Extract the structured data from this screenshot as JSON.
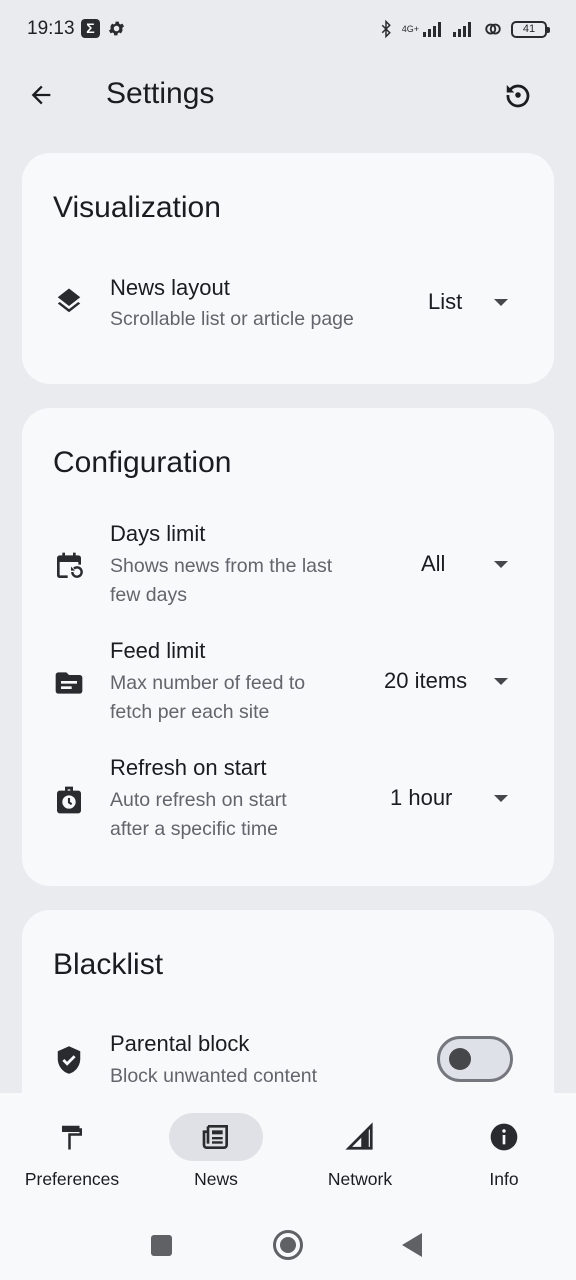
{
  "status_bar": {
    "time": "19:13",
    "sigma": "Σ",
    "network": "4G+",
    "battery": "41"
  },
  "header": {
    "title": "Settings"
  },
  "sections": {
    "visualization": {
      "title": "Visualization",
      "news_layout": {
        "title": "News layout",
        "subtitle": "Scrollable list or article page",
        "value": "List"
      }
    },
    "configuration": {
      "title": "Configuration",
      "days_limit": {
        "title": "Days limit",
        "subtitle_line1": "Shows news from the last",
        "subtitle_line2": "few days",
        "value": "All"
      },
      "feed_limit": {
        "title": "Feed limit",
        "subtitle_line1": "Max number of feed to",
        "subtitle_line2": "fetch per each site",
        "value": "20 items"
      },
      "refresh_on_start": {
        "title": "Refresh on start",
        "subtitle_line1": "Auto refresh on start",
        "subtitle_line2": "after a specific time",
        "value": "1 hour"
      }
    },
    "blacklist": {
      "title": "Blacklist",
      "parental_block": {
        "title": "Parental block",
        "subtitle": "Block unwanted content",
        "enabled": false
      }
    }
  },
  "bottom_nav": {
    "items": [
      {
        "label": "Preferences",
        "icon": "paint-roller-icon",
        "active": false
      },
      {
        "label": "News",
        "icon": "newspaper-icon",
        "active": true
      },
      {
        "label": "Network",
        "icon": "signal-icon",
        "active": false
      },
      {
        "label": "Info",
        "icon": "info-icon",
        "active": false
      }
    ]
  },
  "colors": {
    "background": "#e9ebef",
    "card": "#f8f9fb",
    "active_pill": "#dfe1e6",
    "text": "#1b1c1f",
    "subtext": "#62656b"
  }
}
